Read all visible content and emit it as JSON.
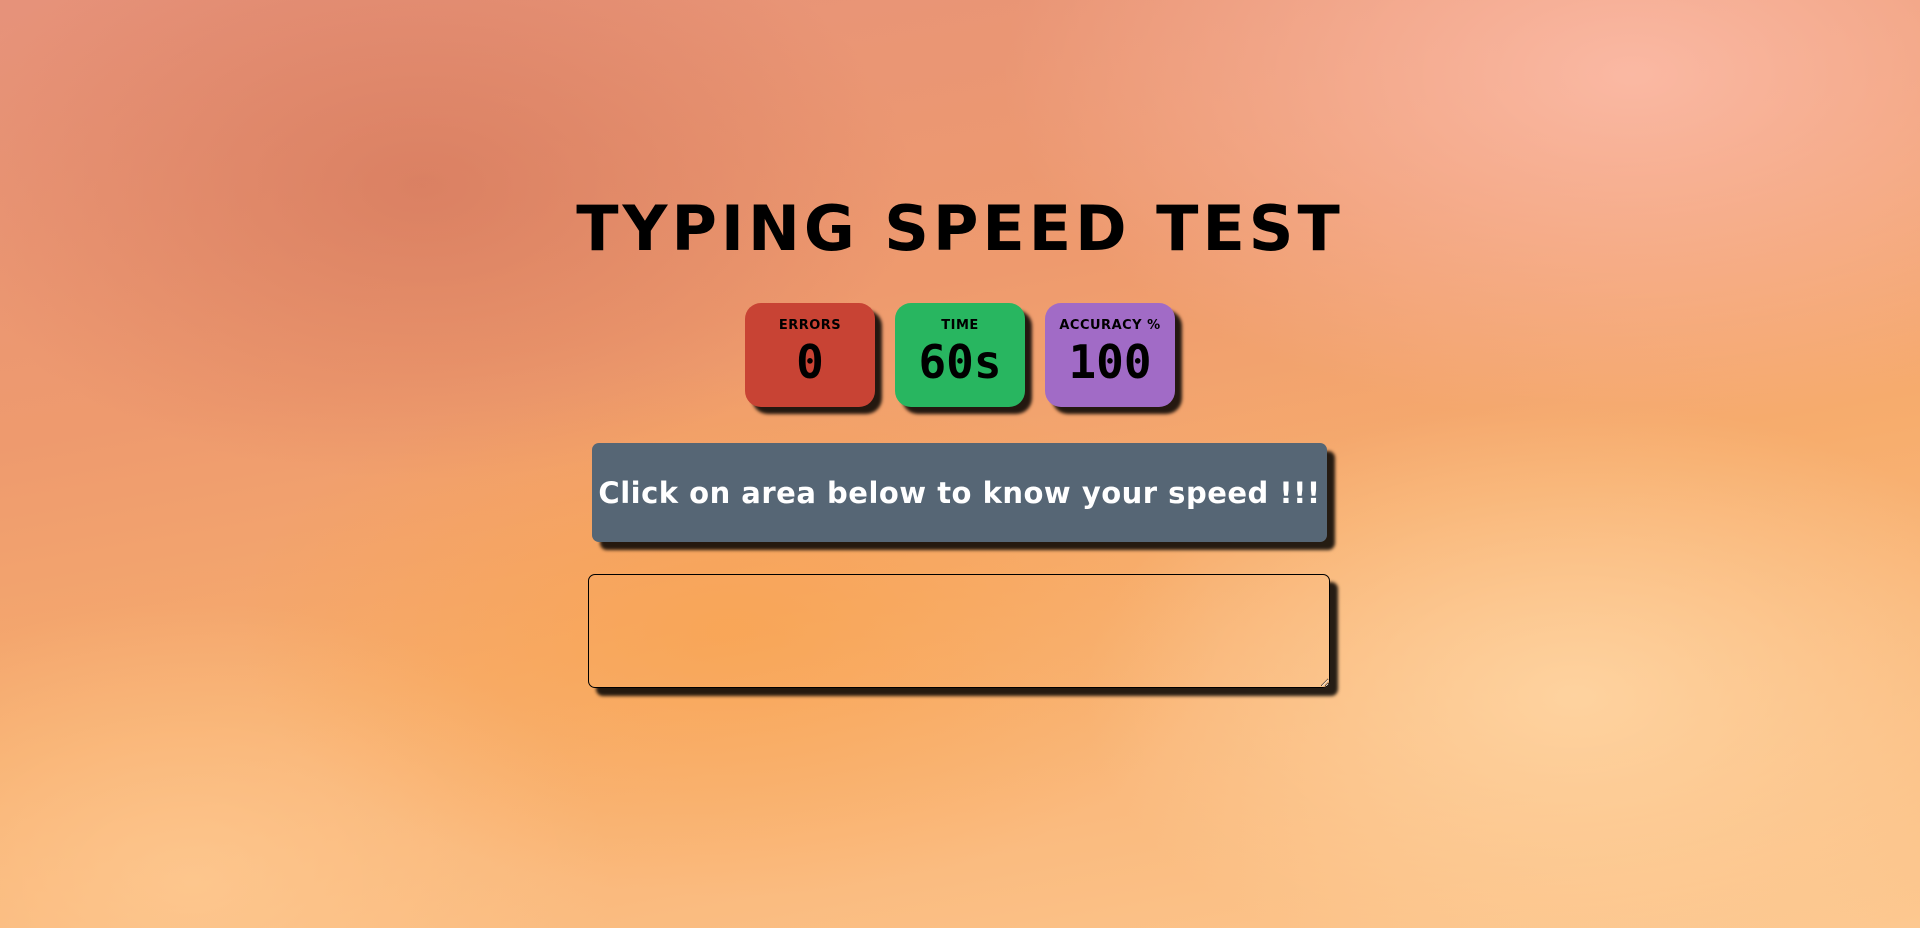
{
  "header": {
    "title": "TYPING SPEED TEST"
  },
  "stats": {
    "errors": {
      "label": "ERRORS",
      "value": "0",
      "color": "#c84334"
    },
    "time": {
      "label": "TIME",
      "value": "60s",
      "color": "#28b660"
    },
    "accuracy": {
      "label": "ACCURACY %",
      "value": "100",
      "color": "#a16bc6"
    }
  },
  "prompt": {
    "text": "Click on area below to know your speed !!!",
    "background": "#566675"
  },
  "input": {
    "value": "",
    "placeholder": ""
  }
}
